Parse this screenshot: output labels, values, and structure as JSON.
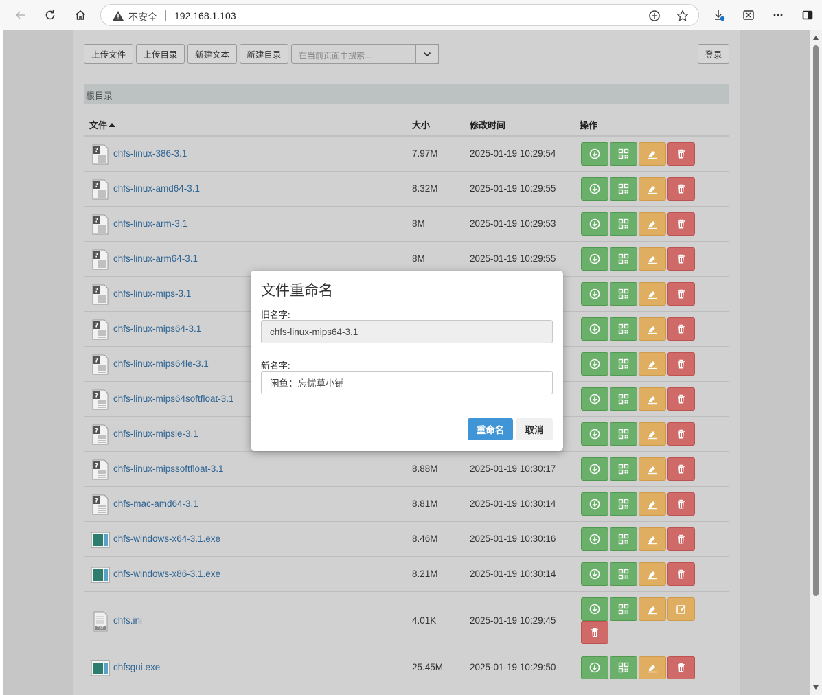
{
  "browser": {
    "security_text": "不安全",
    "url": "192.168.1.103"
  },
  "toolbar": {
    "upload_file": "上传文件",
    "upload_dir": "上传目录",
    "new_text": "新建文本",
    "new_dir": "新建目录",
    "search_placeholder": "在当前页面中搜索...",
    "login": "登录"
  },
  "breadcrumb": "根目录",
  "table": {
    "headers": {
      "file": "文件",
      "size": "大小",
      "mtime": "修改时间",
      "actions": "操作"
    },
    "rows": [
      {
        "name": "chfs-linux-386-3.1",
        "size": "7.97M",
        "mtime": "2025-01-19 10:29:54",
        "icon": "unknown-file-icon"
      },
      {
        "name": "chfs-linux-amd64-3.1",
        "size": "8.32M",
        "mtime": "2025-01-19 10:29:55",
        "icon": "unknown-file-icon"
      },
      {
        "name": "chfs-linux-arm-3.1",
        "size": "8M",
        "mtime": "2025-01-19 10:29:53",
        "icon": "unknown-file-icon"
      },
      {
        "name": "chfs-linux-arm64-3.1",
        "size": "8M",
        "mtime": "2025-01-19 10:29:55",
        "icon": "unknown-file-icon"
      },
      {
        "name": "chfs-linux-mips-3.1",
        "size": "",
        "mtime": "",
        "icon": "unknown-file-icon"
      },
      {
        "name": "chfs-linux-mips64-3.1",
        "size": "",
        "mtime": "",
        "icon": "unknown-file-icon"
      },
      {
        "name": "chfs-linux-mips64le-3.1",
        "size": "",
        "mtime": "",
        "icon": "unknown-file-icon"
      },
      {
        "name": "chfs-linux-mips64softfloat-3.1",
        "size": "",
        "mtime": "",
        "icon": "unknown-file-icon"
      },
      {
        "name": "chfs-linux-mipsle-3.1",
        "size": "",
        "mtime": "",
        "icon": "unknown-file-icon"
      },
      {
        "name": "chfs-linux-mipssoftfloat-3.1",
        "size": "8.88M",
        "mtime": "2025-01-19 10:30:17",
        "icon": "unknown-file-icon"
      },
      {
        "name": "chfs-mac-amd64-3.1",
        "size": "8.81M",
        "mtime": "2025-01-19 10:30:14",
        "icon": "unknown-file-icon"
      },
      {
        "name": "chfs-windows-x64-3.1.exe",
        "size": "8.46M",
        "mtime": "2025-01-19 10:30:16",
        "icon": "exe-file-icon"
      },
      {
        "name": "chfs-windows-x86-3.1.exe",
        "size": "8.21M",
        "mtime": "2025-01-19 10:30:14",
        "icon": "exe-file-icon"
      },
      {
        "name": "chfs.ini",
        "size": "4.01K",
        "mtime": "2025-01-19 10:29:45",
        "icon": "txt-file-icon"
      },
      {
        "name": "chfsgui.exe",
        "size": "25.45M",
        "mtime": "2025-01-19 10:29:50",
        "icon": "exe-file-icon"
      }
    ]
  },
  "modal": {
    "title": "文件重命名",
    "old_label": "旧名字:",
    "old_value": "chfs-linux-mips64-3.1",
    "new_label": "新名字:",
    "new_value": "闲鱼：忘忧草小铺",
    "confirm": "重命名",
    "cancel": "取消"
  },
  "colors": {
    "download": "#6ab06a",
    "rename": "#dfae60",
    "delete": "#cf6a68",
    "primary": "#3f95d6",
    "link": "#2f6593"
  }
}
